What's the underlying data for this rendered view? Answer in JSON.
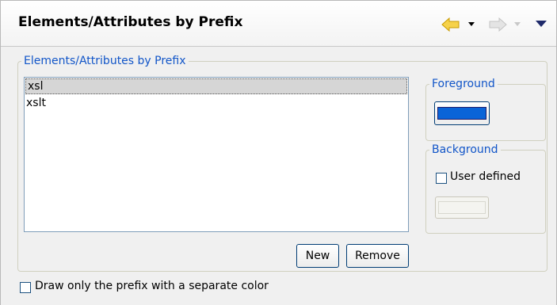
{
  "header": {
    "title": "Elements/Attributes by Prefix"
  },
  "nav": {
    "back_icon": "arrow-left-icon",
    "forward_icon": "arrow-right-icon",
    "menu_icon": "view-menu-icon",
    "back_color": "#f2c200",
    "forward_color": "#c8c8c8"
  },
  "prefix_group": {
    "legend": "Elements/Attributes by Prefix",
    "items": [
      "xsl",
      "xslt"
    ],
    "selected_index": 0
  },
  "buttons": {
    "new_label": "New",
    "remove_label": "Remove"
  },
  "foreground": {
    "legend": "Foreground",
    "color": "#0a64d8"
  },
  "background": {
    "legend": "Background",
    "user_defined_label": "User defined",
    "user_defined_checked": false,
    "color_button_enabled": false
  },
  "footer": {
    "draw_prefix_label": "Draw only the prefix with a separate color",
    "draw_prefix_checked": false
  },
  "colors": {
    "legend_text": "#1155c8",
    "header_bg": "#ffffff",
    "body_bg": "#f0f0f0"
  }
}
